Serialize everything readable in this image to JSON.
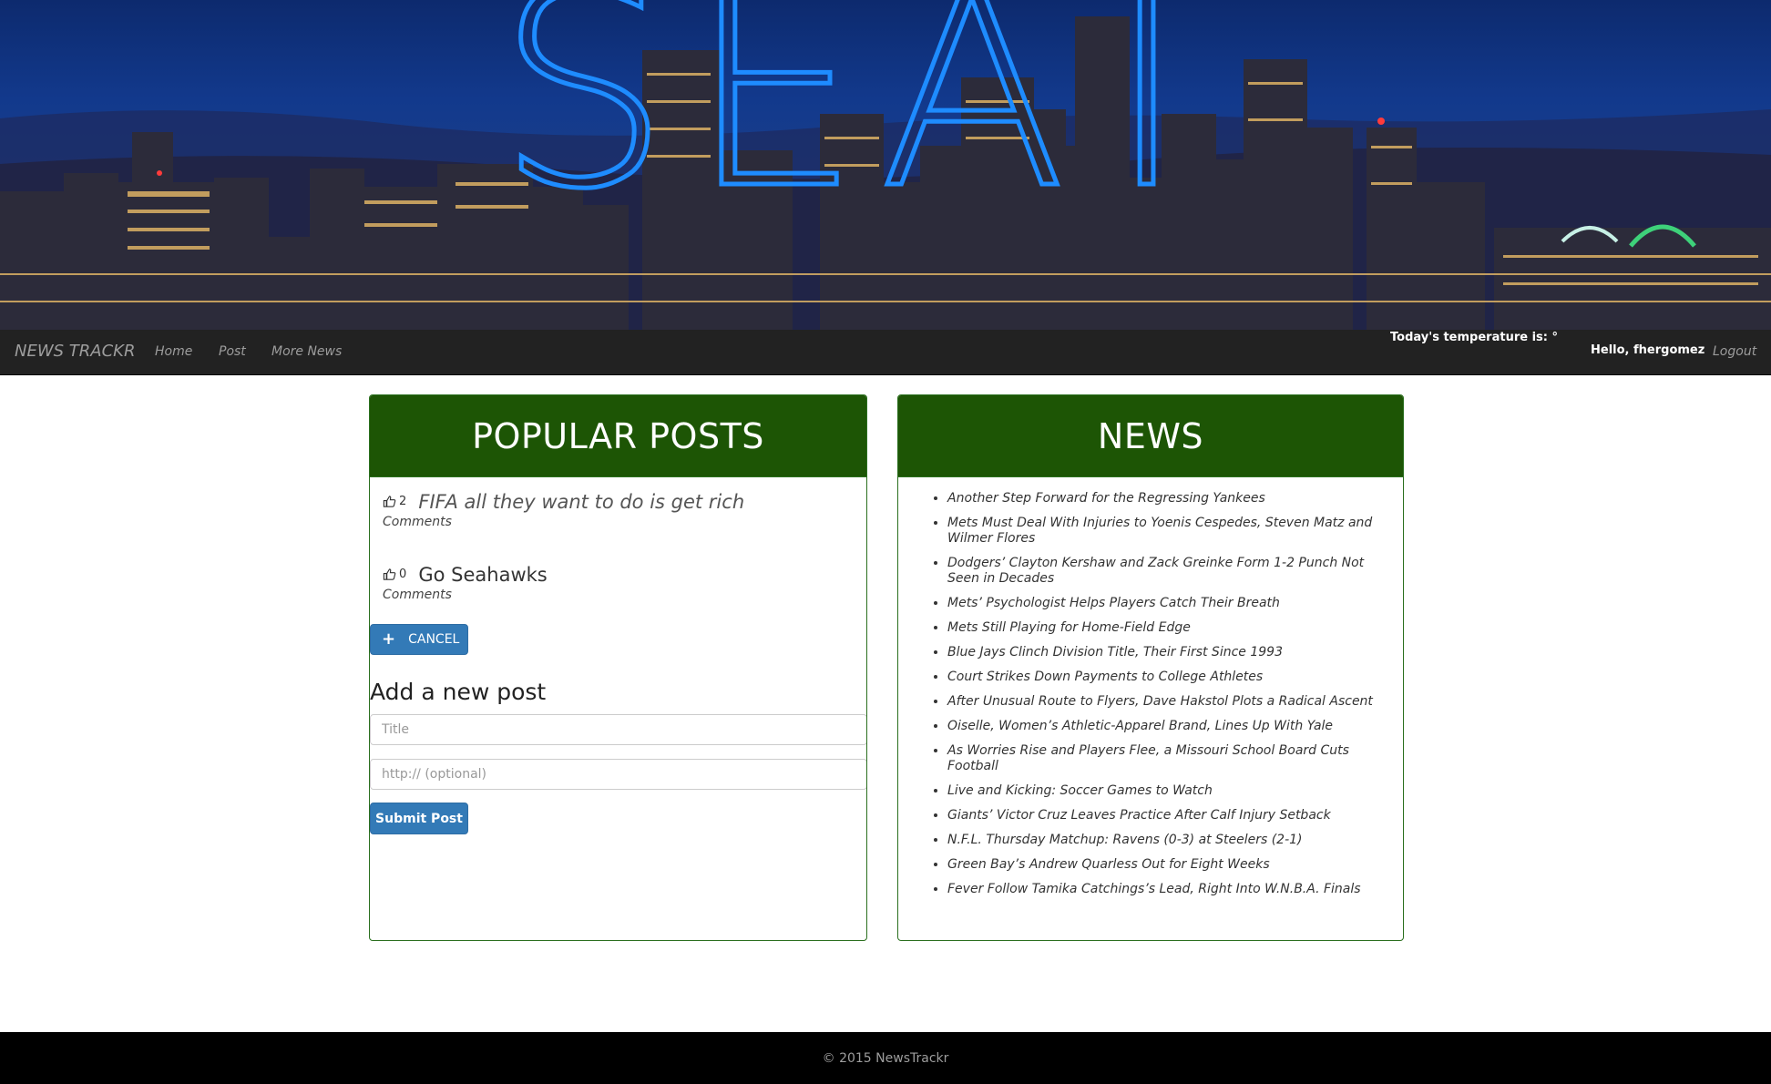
{
  "hero": {
    "word": "SEATTLE"
  },
  "navbar": {
    "brand": "NEWS TRACKR",
    "links": [
      "Home",
      "Post",
      "More News"
    ],
    "temperature": "Today's temperature is: °",
    "greeting": "Hello, fhergomez",
    "logout": "Logout"
  },
  "popular": {
    "heading": "POPULAR POSTS",
    "posts": [
      {
        "votes": "2",
        "title": "FIFA all they want to do is get rich",
        "comments": "Comments"
      },
      {
        "votes": "0",
        "title": "Go Seahawks",
        "comments": "Comments"
      }
    ],
    "cancel_label": "CANCEL",
    "form_title": "Add a new post",
    "title_placeholder": "Title",
    "url_placeholder": "http:// (optional)",
    "submit_label": "Submit Post"
  },
  "news": {
    "heading": "NEWS",
    "items": [
      "Another Step Forward for the Regressing Yankees",
      "Mets Must Deal With Injuries to Yoenis Cespedes, Steven Matz and Wilmer Flores",
      "Dodgers’ Clayton Kershaw and Zack Greinke Form 1-2 Punch Not Seen in Decades",
      "Mets’ Psychologist Helps Players Catch Their Breath",
      "Mets Still Playing for Home-Field Edge",
      "Blue Jays Clinch Division Title, Their First Since 1993",
      "Court Strikes Down Payments to College Athletes",
      "After Unusual Route to Flyers, Dave Hakstol Plots a Radical Ascent",
      "Oiselle, Women’s Athletic-Apparel Brand, Lines Up With Yale",
      "As Worries Rise and Players Flee, a Missouri School Board Cuts Football",
      "Live and Kicking: Soccer Games to Watch",
      "Giants’ Victor Cruz Leaves Practice After Calf Injury Setback",
      "N.F.L. Thursday Matchup: Ravens (0-3) at Steelers (2-1)",
      "Green Bay’s Andrew Quarless Out for Eight Weeks",
      "Fever Follow Tamika Catchings’s Lead, Right Into W.N.B.A. Finals"
    ]
  },
  "footer": {
    "copyright": "© 2015 NewsTrackr"
  },
  "colors": {
    "panel_header": "#1d5505",
    "panel_border": "#2a6f1e",
    "navbar": "#222222",
    "button": "#337ab7",
    "hero_word": "#1e8cff"
  },
  "icons": {
    "vote": "thumbs-up-icon",
    "add": "plus-icon"
  }
}
